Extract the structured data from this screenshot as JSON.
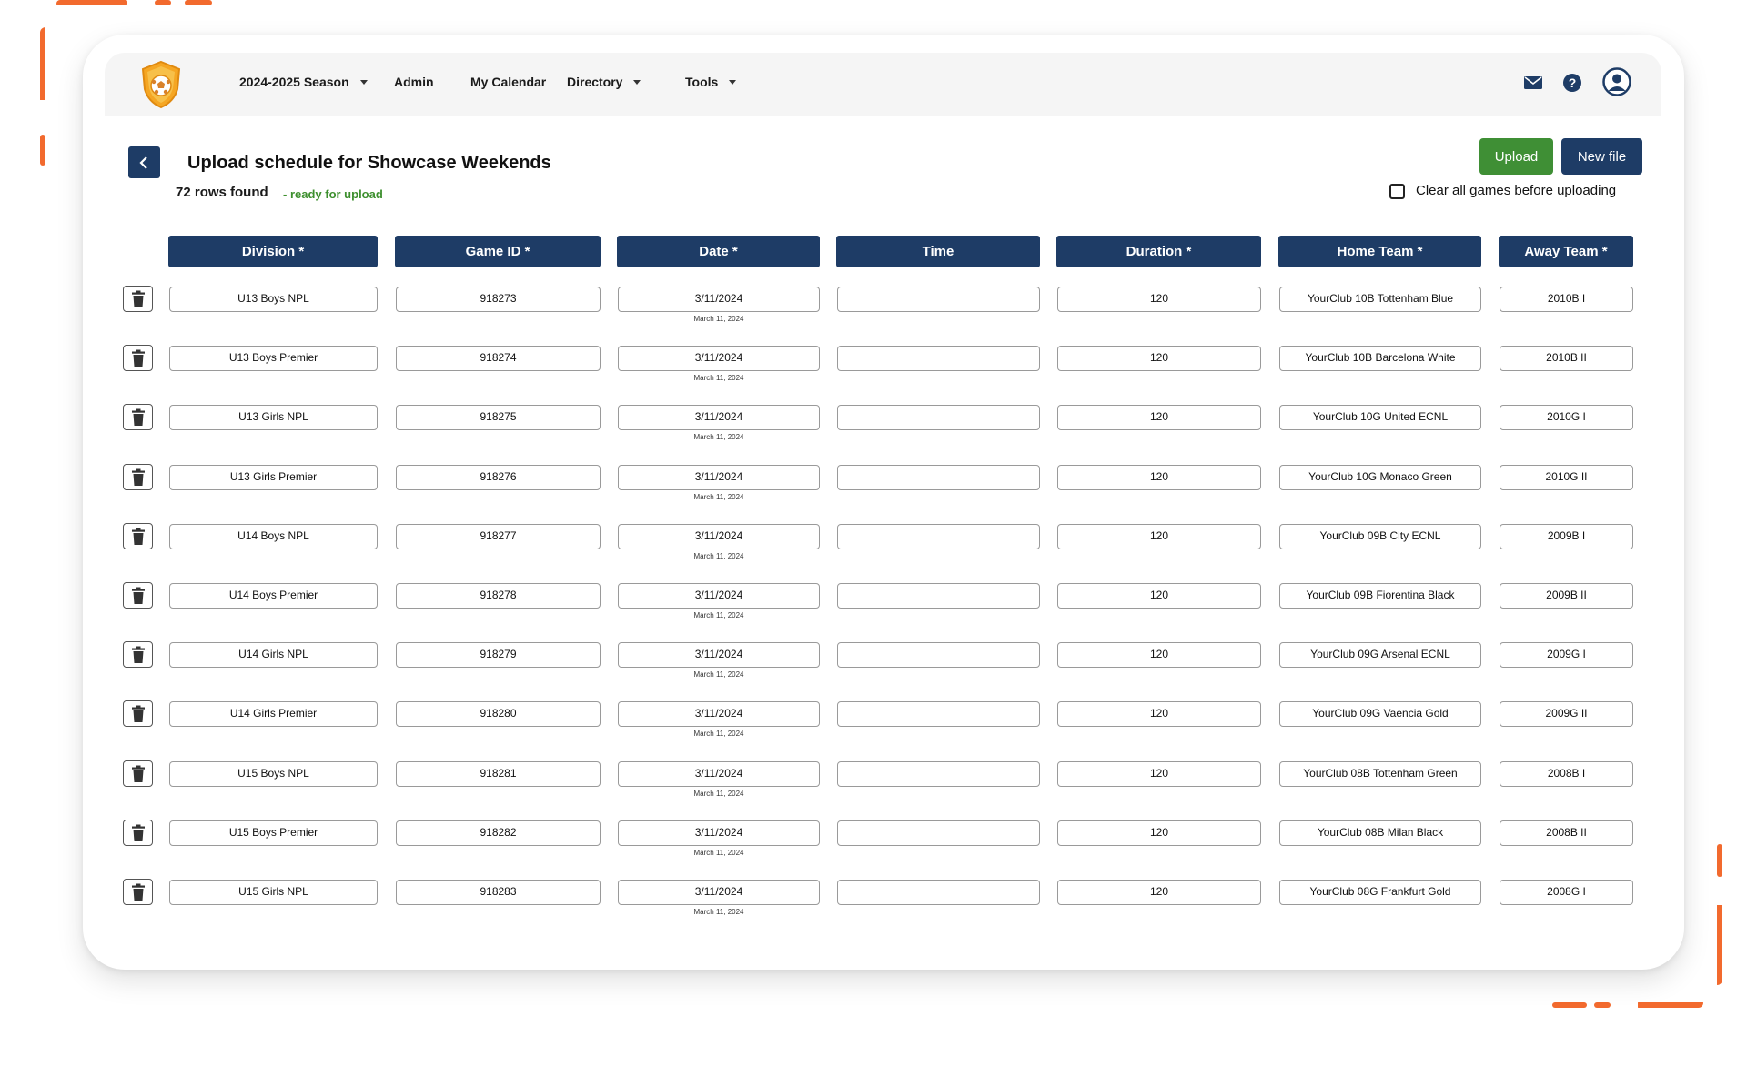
{
  "colors": {
    "accent_navy": "#1e3c66",
    "upload_green": "#3f8f35",
    "ready_green": "#3d8f2e",
    "decor_orange": "#f26a2e"
  },
  "nav": {
    "logo": "shield-soccer-logo",
    "items": [
      {
        "label": "2024-2025 Season",
        "dropdown": true
      },
      {
        "label": "Admin",
        "dropdown": false
      },
      {
        "label": "My Calendar",
        "dropdown": false
      },
      {
        "label": "Directory",
        "dropdown": true
      },
      {
        "label": "Tools",
        "dropdown": true
      }
    ],
    "icons": [
      "mail-icon",
      "help-icon",
      "user-avatar-icon"
    ]
  },
  "page": {
    "title": "Upload schedule for Showcase Weekends",
    "rows_found": "72 rows found",
    "status": "- ready for upload",
    "upload_label": "Upload",
    "new_file_label": "New file",
    "clear_games_label": "Clear all games before uploading",
    "clear_games_checked": false
  },
  "columns": [
    "Division *",
    "Game ID *",
    "Date *",
    "Time",
    "Duration *",
    "Home Team *",
    "Away Team *"
  ],
  "rows": [
    {
      "division": "U13 Boys NPL",
      "game_id": "918273",
      "date": "3/11/2024",
      "date_long": "March 11, 2024",
      "time": "",
      "duration": "120",
      "home": "YourClub 10B Tottenham Blue",
      "away": "2010B I"
    },
    {
      "division": "U13 Boys Premier",
      "game_id": "918274",
      "date": "3/11/2024",
      "date_long": "March 11, 2024",
      "time": "",
      "duration": "120",
      "home": "YourClub 10B Barcelona White",
      "away": "2010B II"
    },
    {
      "division": "U13 Girls NPL",
      "game_id": "918275",
      "date": "3/11/2024",
      "date_long": "March 11, 2024",
      "time": "",
      "duration": "120",
      "home": "YourClub 10G United ECNL",
      "away": "2010G I"
    },
    {
      "division": "U13 Girls Premier",
      "game_id": "918276",
      "date": "3/11/2024",
      "date_long": "March 11, 2024",
      "time": "",
      "duration": "120",
      "home": "YourClub 10G Monaco Green",
      "away": "2010G II"
    },
    {
      "division": "U14 Boys NPL",
      "game_id": "918277",
      "date": "3/11/2024",
      "date_long": "March 11, 2024",
      "time": "",
      "duration": "120",
      "home": "YourClub 09B City ECNL",
      "away": "2009B I"
    },
    {
      "division": "U14 Boys Premier",
      "game_id": "918278",
      "date": "3/11/2024",
      "date_long": "March 11, 2024",
      "time": "",
      "duration": "120",
      "home": "YourClub 09B Fiorentina Black",
      "away": "2009B II"
    },
    {
      "division": "U14 Girls NPL",
      "game_id": "918279",
      "date": "3/11/2024",
      "date_long": "March 11, 2024",
      "time": "",
      "duration": "120",
      "home": "YourClub 09G Arsenal ECNL",
      "away": "2009G I"
    },
    {
      "division": "U14 Girls Premier",
      "game_id": "918280",
      "date": "3/11/2024",
      "date_long": "March 11, 2024",
      "time": "",
      "duration": "120",
      "home": "YourClub 09G Vaencia Gold",
      "away": "2009G II"
    },
    {
      "division": "U15 Boys NPL",
      "game_id": "918281",
      "date": "3/11/2024",
      "date_long": "March 11, 2024",
      "time": "",
      "duration": "120",
      "home": "YourClub 08B Tottenham Green",
      "away": "2008B I"
    },
    {
      "division": "U15 Boys Premier",
      "game_id": "918282",
      "date": "3/11/2024",
      "date_long": "March 11, 2024",
      "time": "",
      "duration": "120",
      "home": "YourClub 08B Milan Black",
      "away": "2008B II"
    },
    {
      "division": "U15 Girls NPL",
      "game_id": "918283",
      "date": "3/11/2024",
      "date_long": "March 11, 2024",
      "time": "",
      "duration": "120",
      "home": "YourClub 08G Frankfurt Gold",
      "away": "2008G I"
    }
  ]
}
